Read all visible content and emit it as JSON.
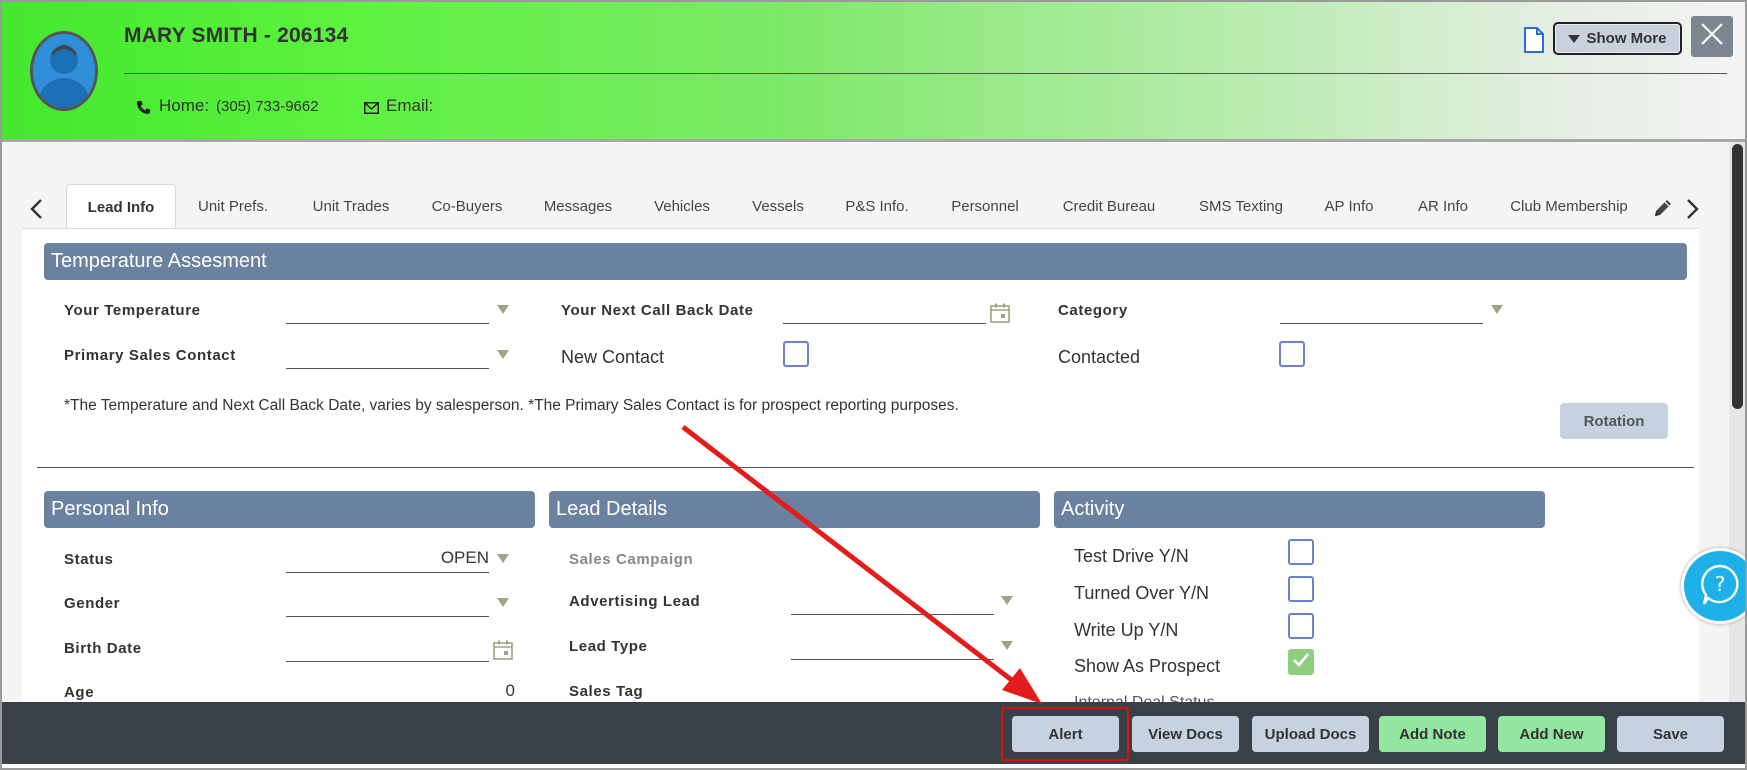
{
  "header": {
    "name": "MARY SMITH - 206134",
    "phone_label": "Home:",
    "phone_value": "(305) 733-9662",
    "email_label": "Email:",
    "show_more_label": "Show More",
    "icons": [
      "avatar",
      "phone-icon",
      "mail-icon",
      "document-icon",
      "caret-down-icon",
      "close-icon"
    ]
  },
  "tabs": [
    {
      "label": "Lead Info",
      "active": true
    },
    {
      "label": "Unit Prefs."
    },
    {
      "label": "Unit Trades"
    },
    {
      "label": "Co-Buyers"
    },
    {
      "label": "Messages"
    },
    {
      "label": "Vehicles"
    },
    {
      "label": "Vessels"
    },
    {
      "label": "P&S Info."
    },
    {
      "label": "Personnel"
    },
    {
      "label": "Credit Bureau"
    },
    {
      "label": "SMS Texting"
    },
    {
      "label": "AP Info"
    },
    {
      "label": "AR Info"
    },
    {
      "label": "Club Membership"
    }
  ],
  "temperature": {
    "title": "Temperature Assesment",
    "your_temperature": "Your Temperature",
    "next_call_back": "Your Next Call Back Date",
    "category": "Category",
    "primary_sales_contact": "Primary Sales Contact",
    "new_contact": "New Contact",
    "contacted": "Contacted",
    "note": "*The Temperature and Next Call Back Date, varies by salesperson. *The Primary Sales Contact is for prospect reporting purposes.",
    "rotation_label": "Rotation"
  },
  "personal": {
    "title": "Personal Info",
    "status_label": "Status",
    "status_value": "OPEN",
    "gender_label": "Gender",
    "birth_date_label": "Birth Date",
    "age_label": "Age",
    "age_value": "0"
  },
  "lead_details": {
    "title": "Lead Details",
    "sales_campaign": "Sales Campaign",
    "advertising_lead": "Advertising Lead",
    "lead_type": "Lead Type",
    "sales_tag": "Sales Tag"
  },
  "activity": {
    "title": "Activity",
    "items": [
      {
        "label": "Test Drive Y/N",
        "checked": false
      },
      {
        "label": "Turned Over Y/N",
        "checked": false
      },
      {
        "label": "Write Up Y/N",
        "checked": false
      },
      {
        "label": "Show As Prospect",
        "checked": true
      }
    ],
    "partial_label": "Internal Deal Status"
  },
  "footer": {
    "alert": "Alert",
    "view_docs": "View Docs",
    "upload_docs": "Upload Docs",
    "add_note": "Add Note",
    "add_new": "Add New",
    "save": "Save"
  },
  "colors": {
    "section_bar": "#6a819f",
    "header_green": "#44e82e",
    "highlight_red": "#e01010",
    "footer_bg": "#394048",
    "green_button": "#92e69f"
  }
}
